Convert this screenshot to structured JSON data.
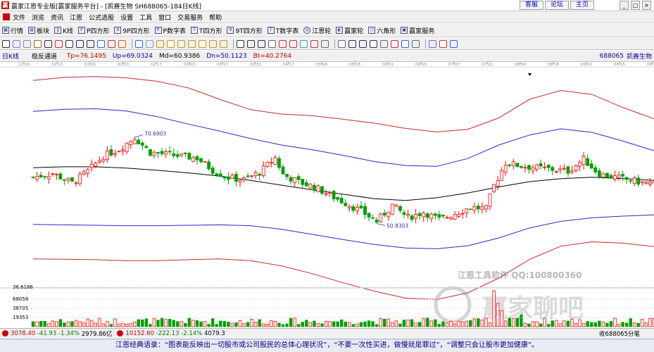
{
  "window": {
    "title": "赢家江恩专业版[赢家服务平台] - [凯赛生物  SH688065-184日K线]",
    "links": [
      "客服",
      "论坛",
      "主页"
    ],
    "controls": [
      "_",
      "□",
      "×"
    ]
  },
  "menu": [
    "文件",
    "浏览",
    "资讯",
    "江恩",
    "公式选股",
    "设置",
    "工具",
    "窗口",
    "交易服务",
    "帮助"
  ],
  "toolbar": {
    "items": [
      {
        "icon": "grid-icon",
        "label": "行情"
      },
      {
        "icon": "sector-icon",
        "label": "板块"
      },
      {
        "icon": "kline-icon",
        "label": "K线"
      },
      {
        "icon": "p-square-icon",
        "label": "P四方形"
      },
      {
        "icon": "9p-square-icon",
        "label": "9P四方形"
      },
      {
        "icon": "p-table-icon",
        "label": "P数字表"
      },
      {
        "icon": "t-square-icon",
        "label": "T四方形"
      },
      {
        "icon": "9t-square-icon",
        "label": "9T四方形"
      },
      {
        "icon": "t-table-icon",
        "label": "T数字表"
      },
      {
        "icon": "gann-wheel-icon",
        "label": "江恩轮"
      },
      {
        "icon": "winner-wheel-icon",
        "label": "赢家轮"
      },
      {
        "icon": "hexagon-icon",
        "label": "六角形"
      },
      {
        "icon": "service-icon",
        "label": "赢家服务"
      }
    ]
  },
  "chart_header": {
    "period": "日K线",
    "indicator": "极反通道",
    "tp": "Tp=76.1495",
    "up": "Up=69.0324",
    "md": "Md=60.9386",
    "dn": "Dn=50.1123",
    "bt": "Bt=40.2764",
    "code": "688065",
    "name": "凯赛生物"
  },
  "date_ticks": [
    "12-29",
    "01-13",
    "01-20",
    "02-03",
    "02-17",
    "03-03",
    "03-17",
    "03-31",
    "04-17",
    "05-04",
    "05-18",
    "06-01",
    "06-15",
    "07-07",
    "07-21",
    "08-04",
    "08-18",
    "09-01",
    "09-15",
    "09-29"
  ],
  "annotations": {
    "high": "70.6903",
    "low": "50.8303",
    "vol_max": "36.6186",
    "vol_ticks": [
      "68058",
      "38705",
      "19353"
    ]
  },
  "watermark": {
    "line1": "江恩工具软件 QQ:100800360",
    "line2": "赢家聊吧",
    "url": "licai.vip.qq.com"
  },
  "status": {
    "idx1": "3078.40",
    "idx1_chg": "-41.93",
    "idx1_pct": "-1.34%",
    "idx1_amt": "2979.86亿",
    "idx2": "10152.60",
    "idx2_chg": "-222.13",
    "idx2_pct": "-2.14%",
    "idx2_amt": "4079.3",
    "right": "收688065分笔"
  },
  "footer": "江恩经典语录：“图表能反映出一切股市或公司股民的总体心理状况”，“不要一次性买进，做慢就是罪过”，“调整只会让股市更加健康”。",
  "colors": {
    "up_candle": "#ff0000",
    "down_candle": "#00a000",
    "outer_band": "#c82828",
    "inner_band": "#2828c8",
    "mid_line": "#000000"
  },
  "chart_data": {
    "type": "candlestick",
    "title": "极反通道",
    "ylim": [
      36.6186,
      86
    ],
    "channel": {
      "Tp": 76.1495,
      "Up": 69.0324,
      "Md": 60.9386,
      "Dn": 50.1123,
      "Bt": 40.2764
    },
    "x_ticks": [
      "12-29",
      "01-13",
      "01-20",
      "02-03",
      "02-17",
      "03-03",
      "03-17",
      "03-31",
      "04-17",
      "05-04",
      "05-18",
      "06-01",
      "06-15",
      "07-07",
      "07-21",
      "08-04",
      "08-18",
      "09-01",
      "09-15",
      "09-29"
    ],
    "price_path": [
      [
        0,
        61.5
      ],
      [
        5,
        62.4
      ],
      [
        10,
        60.2
      ],
      [
        14,
        62.9
      ],
      [
        18,
        66.4
      ],
      [
        22,
        67.9
      ],
      [
        26,
        70.6
      ],
      [
        30,
        67.2
      ],
      [
        34,
        66.8
      ],
      [
        38,
        66.3
      ],
      [
        42,
        65.9
      ],
      [
        46,
        63.1
      ],
      [
        50,
        61.4
      ],
      [
        54,
        60.9
      ],
      [
        58,
        62.6
      ],
      [
        62,
        66.0
      ],
      [
        64,
        62.1
      ],
      [
        68,
        60.4
      ],
      [
        72,
        59.3
      ],
      [
        76,
        57.4
      ],
      [
        80,
        55.6
      ],
      [
        84,
        53.7
      ],
      [
        88,
        51.4
      ],
      [
        92,
        55.1
      ],
      [
        96,
        52.3
      ],
      [
        100,
        53.5
      ],
      [
        104,
        51.8
      ],
      [
        108,
        53.2
      ],
      [
        112,
        54.6
      ],
      [
        116,
        54.3
      ],
      [
        118,
        59.6
      ],
      [
        121,
        64.8
      ],
      [
        125,
        64.1
      ],
      [
        129,
        63.7
      ],
      [
        133,
        63.3
      ],
      [
        137,
        62.9
      ],
      [
        141,
        65.6
      ],
      [
        145,
        62.2
      ],
      [
        149,
        61.5
      ],
      [
        153,
        60.8
      ],
      [
        157,
        60.1
      ]
    ],
    "band_series": [
      {
        "name": "Tp",
        "values": [
          83.7,
          84.4,
          84.6,
          84.3,
          83.5,
          82.0,
          79.4,
          77.0,
          76.0,
          75.6,
          74.8,
          73.9,
          72.7,
          71.9,
          72.5,
          75.1,
          79.4,
          81.4,
          80.5,
          77.5,
          74.9
        ]
      },
      {
        "name": "Up",
        "values": [
          76.6,
          77.1,
          77.2,
          76.7,
          75.4,
          73.7,
          72.1,
          70.4,
          68.9,
          67.8,
          66.5,
          65.1,
          64.2,
          64.0,
          65.8,
          68.9,
          71.2,
          72.6,
          71.8,
          69.8,
          67.6
        ]
      },
      {
        "name": "Md",
        "values": [
          63.7,
          63.9,
          63.9,
          63.6,
          63.1,
          62.5,
          61.8,
          60.8,
          59.7,
          58.6,
          57.6,
          56.6,
          56.2,
          56.8,
          57.9,
          59.3,
          60.5,
          61.2,
          61.5,
          61.2,
          60.8
        ]
      },
      {
        "name": "Dn",
        "values": [
          50.7,
          50.6,
          50.5,
          50.4,
          50.4,
          50.5,
          50.6,
          50.4,
          49.6,
          48.4,
          47.2,
          46.1,
          45.3,
          45.1,
          45.8,
          47.6,
          49.9,
          51.4,
          52.2,
          52.6,
          52.9
        ]
      },
      {
        "name": "Bt",
        "values": [
          42.8,
          42.7,
          42.6,
          42.4,
          42.4,
          42.6,
          42.8,
          42.4,
          41.2,
          39.4,
          37.3,
          35.4,
          33.8,
          33.5,
          35.0,
          38.4,
          42.7,
          45.7,
          46.7,
          46.4,
          45.6
        ]
      }
    ],
    "volume_note": "volume bars, max label 36.6186, ticks 68058 / 38705 / 19353"
  }
}
